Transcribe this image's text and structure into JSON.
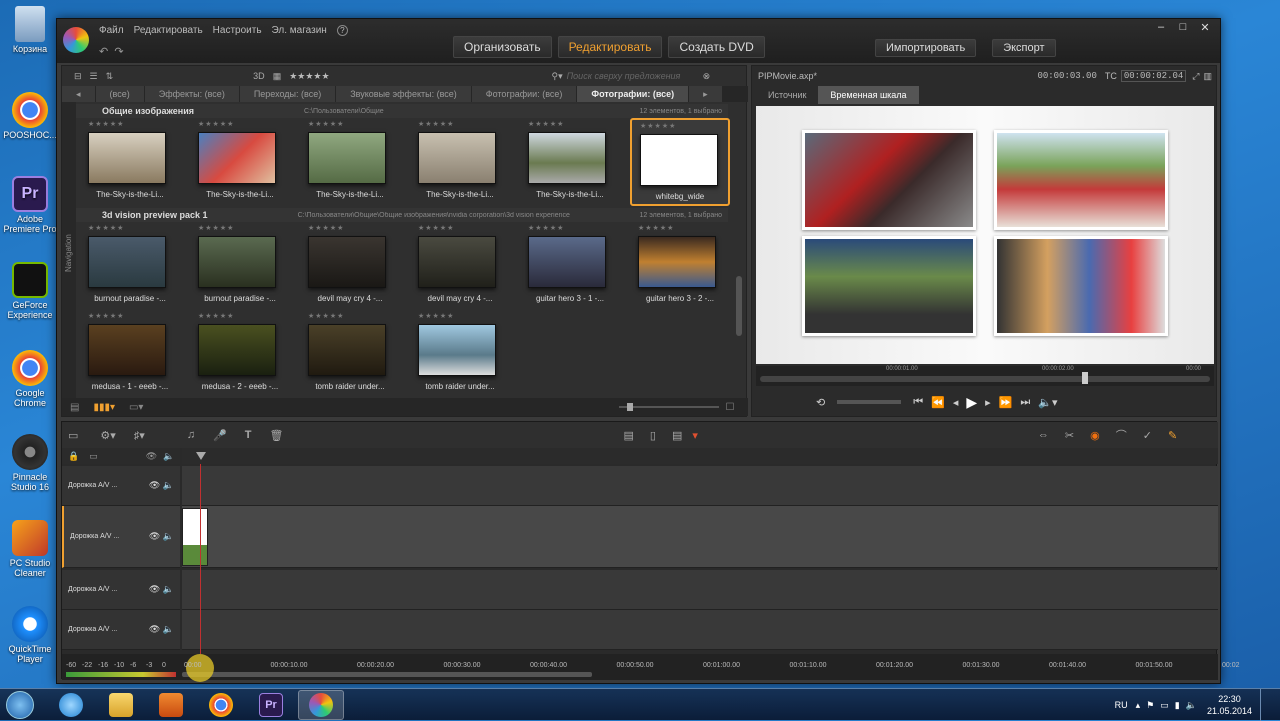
{
  "desktop": {
    "icons": [
      {
        "label": "Корзина",
        "color": "#8fb3d6"
      },
      {
        "label": "POOSHOC...",
        "color": "#d33"
      },
      {
        "label": "Adobe Premiere Pro",
        "color": "#2a1a4e"
      },
      {
        "label": "GeForce Experience",
        "color": "#76b900"
      },
      {
        "label": "Google Chrome",
        "color": "#d33"
      },
      {
        "label": "Pinnacle Studio 16",
        "color": "#222"
      },
      {
        "label": "PC Studio Cleaner",
        "color": "#e08020"
      },
      {
        "label": "QuickTime Player",
        "color": "#1e90ff"
      }
    ]
  },
  "app": {
    "menu": [
      "Файл",
      "Редактировать",
      "Настроить",
      "Эл. магазин"
    ],
    "modes": [
      "Организовать",
      "Редактировать",
      "Создать DVD"
    ],
    "actions": [
      "Импортировать",
      "Экспорт"
    ]
  },
  "library": {
    "tabs": [
      "(все)",
      "Эффекты: (все)",
      "Переходы: (все)",
      "Звуковые эффекты: (все)",
      "Фотографии: (все)",
      "Фотографии: (все)"
    ],
    "toolbar": {
      "view_3d": "3D",
      "stars": "★★★★★",
      "search_placeholder": "Поиск сверху предложения"
    },
    "side_label": "Navigation",
    "groups": [
      {
        "title": "Общие изображения",
        "path": "C:\\Пользователи\\Общие",
        "count": "12 элементов, 1 выбрано"
      },
      {
        "title": "3d vision preview pack 1",
        "path": "C:\\Пользователи\\Общие\\Общие изображения\\nvidia corporation\\3d vision experience",
        "count": "12 элементов, 1 выбрано"
      }
    ],
    "items_row1": [
      "The-Sky-is-the-Li...",
      "The-Sky-is-the-Li...",
      "The-Sky-is-the-Li...",
      "The-Sky-is-the-Li...",
      "The-Sky-is-the-Li...",
      "whitebg_wide"
    ],
    "items_row2": [
      "burnout paradise -...",
      "burnout paradise -...",
      "devil may cry 4 -...",
      "devil may cry 4 -...",
      "guitar hero 3 - 1 -...",
      "guitar hero 3 - 2 -..."
    ],
    "items_row3": [
      "medusa - 1 - eeeb -...",
      "medusa - 2 - eeeb -...",
      "tomb raider under...",
      "tomb raider under..."
    ]
  },
  "preview": {
    "file": "PIPMovie.axp*",
    "duration": "00:00:03.00",
    "tc_label": "TC",
    "timecode": "00:00:02.04",
    "tabs": [
      "Источник",
      "Временная шкала"
    ],
    "ruler": [
      "00:00:01.00",
      "00:00:02.00",
      "00:00"
    ]
  },
  "timeline": {
    "tracks": [
      "Дорожка A/V ...",
      "Дорожка A/V ...",
      "Дорожка A/V ...",
      "Дорожка A/V ..."
    ],
    "ticks": [
      "00:00",
      "00:00:10.00",
      "00:00:20.00",
      "00:00:30.00",
      "00:00:40.00",
      "00:00:50.00",
      "00:01:00.00",
      "00:01:10.00",
      "00:01:20.00",
      "00:01:30.00",
      "00:01:40.00",
      "00:01:50.00",
      "00:02"
    ],
    "meter": [
      "-60",
      "-22",
      "-16",
      "-10",
      "-6",
      "-3",
      "0"
    ]
  },
  "taskbar": {
    "lang": "RU",
    "time": "22:30",
    "date": "21.05.2014"
  }
}
